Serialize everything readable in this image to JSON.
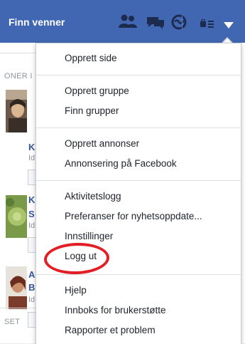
{
  "topbar": {
    "profile_name": "Finn venner",
    "icons": [
      "friends-icon",
      "messages-icon",
      "notifications-icon",
      "privacy-shortcuts-icon",
      "account-menu-caret-icon"
    ]
  },
  "background": {
    "section_top": "ONER I",
    "section_bottom": "SET",
    "items": [
      {
        "letter1": "K",
        "small": "Id"
      },
      {
        "letter1": "K",
        "letter2": "S",
        "small": "Id"
      },
      {
        "letter1": "A",
        "letter2": "B",
        "small": "Id"
      }
    ]
  },
  "menu": {
    "group1": [
      "Opprett side"
    ],
    "group2": [
      "Opprett gruppe",
      "Finn grupper"
    ],
    "group3": [
      "Opprett annonser",
      "Annonsering på Facebook"
    ],
    "group4": [
      "Aktivitetslogg",
      "Preferanser for nyhetsoppdate...",
      "Innstillinger",
      "Logg ut"
    ],
    "group5": [
      "Hjelp",
      "Innboks for brukerstøtte",
      "Rapporter et problem"
    ]
  },
  "colors": {
    "topbar": "#4267b2",
    "highlight": "#e31e24"
  }
}
